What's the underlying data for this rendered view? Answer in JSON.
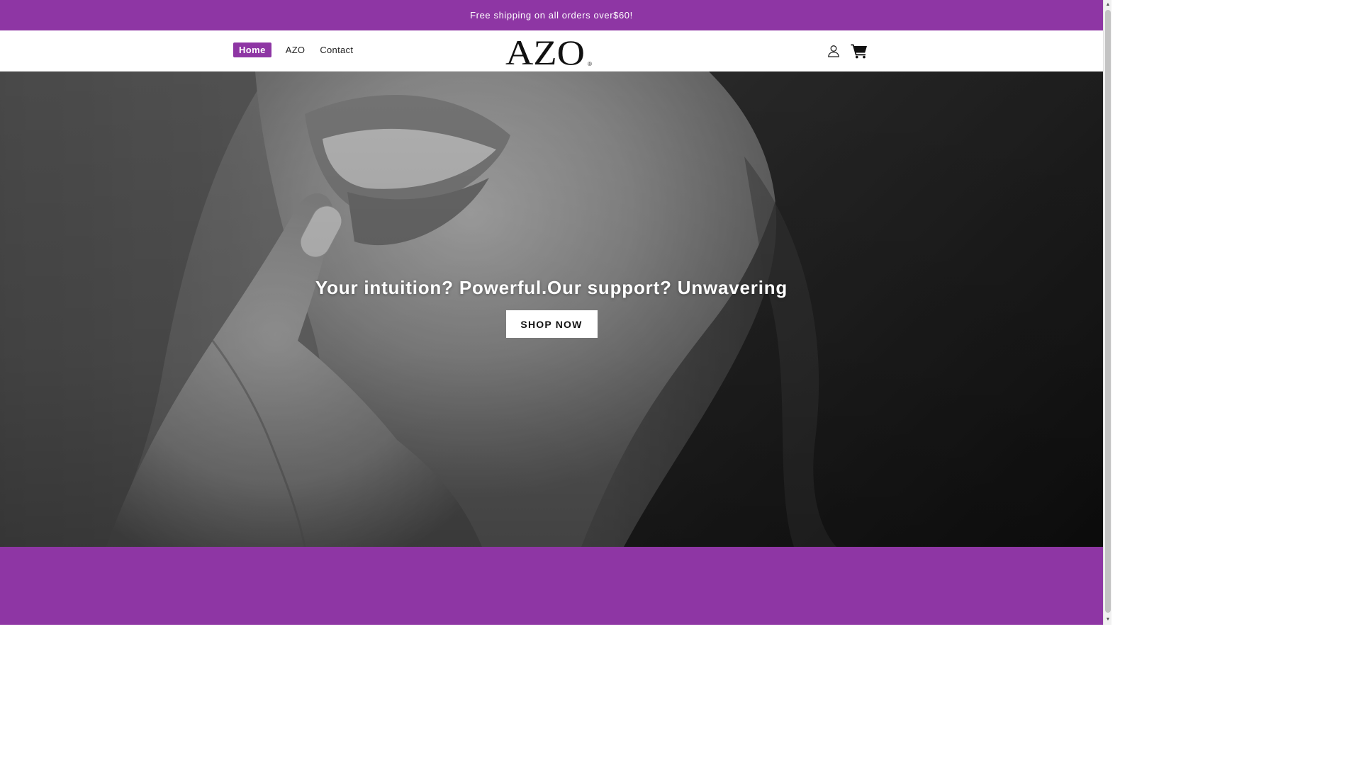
{
  "announcement": {
    "text": "Free shipping on all orders over$60!"
  },
  "header": {
    "nav": [
      {
        "label": "Home",
        "active": true
      },
      {
        "label": "AZO",
        "active": false
      },
      {
        "label": "Contact",
        "active": false
      }
    ],
    "logo": {
      "text": "AZO",
      "mark": "®"
    },
    "icons": {
      "account": "user-icon",
      "cart": "cart-icon"
    }
  },
  "hero": {
    "title": "Your intuition? Powerful.Our support? Unwavering",
    "cta_label": "SHOP NOW",
    "image": "grayscale photo of woman placing capsule to her lips"
  },
  "colors": {
    "brand": "#8e36a4",
    "text": "#222222",
    "button_bg": "#ffffff"
  }
}
